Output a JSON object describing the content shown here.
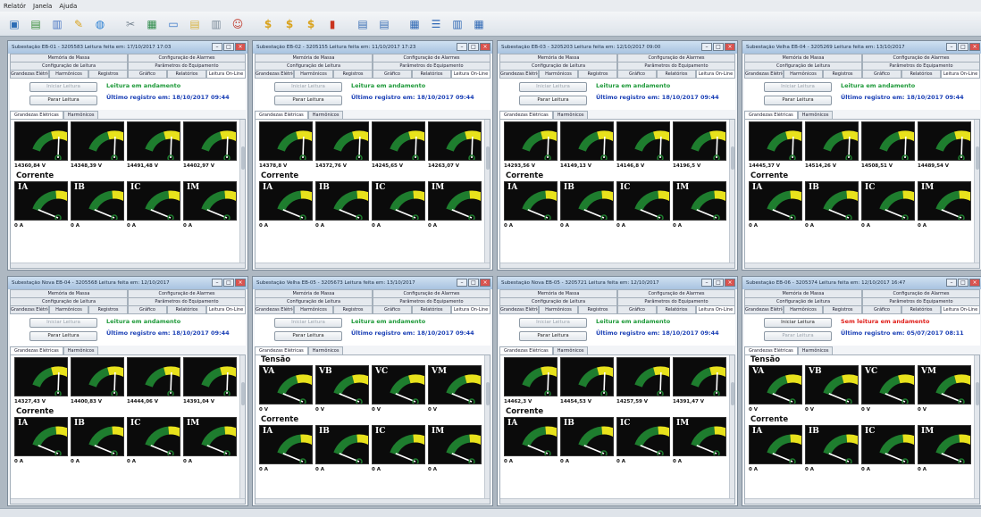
{
  "menu": [
    "Relatór",
    "Janela",
    "Ajuda"
  ],
  "toolbar_icons": [
    "window-icon",
    "chart-icon",
    "book-icon",
    "pen-icon",
    "globe-icon",
    "tool-icon",
    "device-icon",
    "screen-icon",
    "folder-icon",
    "copy-icon",
    "user-icon",
    "dollar-icon",
    "dollar-icon",
    "dollar-icon",
    "bars-icon",
    "doc-icon",
    "doc-icon",
    "cascade-icon",
    "tile-h-icon",
    "tile-v-icon",
    "grid-icon"
  ],
  "tab_labels": {
    "memoria": "Memória de Massa",
    "config_alarmes": "Configuração de Alarmes",
    "config_leitura": "Configuração de Leitura",
    "parametros": "Parâmetros do Equipamento",
    "grandezas": "Grandezas Elétricas",
    "harmonicos": "Harmônicos",
    "registros": "Registros",
    "graficos": "Gráfico",
    "relatorios": "Relatórios",
    "leitura_online": "Leitura On-Line"
  },
  "inner_tabs": {
    "grandezas": "Grandezas Elétricas",
    "harmonicos": "Harmônicos"
  },
  "buttons": {
    "iniciar": "Iniciar Leitura",
    "parar": "Parar Leitura"
  },
  "section_labels": {
    "corrente": "Corrente",
    "tensao": "Tensão"
  },
  "colors": {
    "ok_status": "#1f9a3a",
    "err_status": "#e0201b",
    "info": "#1a3fb5",
    "gauge_green": "#1e7d2e",
    "gauge_yellow": "#e8e21c",
    "gauge_red": "#d81e1e"
  },
  "windows": [
    {
      "title": "Subestação EB-01 - 3205583 Leitura feita em: 17/10/2017 17:03",
      "status": "Leitura em andamento",
      "status_kind": "ok",
      "last": "Último registro em: 18/10/2017 09:44",
      "voltage_labels": [
        "",
        "",
        "",
        ""
      ],
      "voltage_readings": [
        "14360,84 V",
        "14348,39 V",
        "14491,48 V",
        "14402,97 V"
      ],
      "voltage_level": 0.6,
      "current_labels": [
        "IA",
        "IB",
        "IC",
        "IM"
      ],
      "current_scale": [
        "225",
        "225",
        "225",
        "225"
      ],
      "current_readings": [
        "0 A",
        "0 A",
        "0 A",
        "0 A"
      ],
      "current_level": 0.02
    },
    {
      "title": "Subestação EB-02 - 3205155 Leitura feita em: 11/10/2017 17:23",
      "status": "Leitura em andamento",
      "status_kind": "ok",
      "last": "Último registro em: 18/10/2017 09:44",
      "voltage_labels": [
        "",
        "",
        "",
        ""
      ],
      "voltage_readings": [
        "14378,8 V",
        "14372,76 V",
        "14245,65 V",
        "14263,07 V"
      ],
      "voltage_level": 0.6,
      "current_labels": [
        "IA",
        "IB",
        "IC",
        "IM"
      ],
      "current_scale": [
        "60",
        "60",
        "60",
        "60"
      ],
      "current_readings": [
        "0 A",
        "0 A",
        "0 A",
        "0 A"
      ],
      "current_level": 0.02
    },
    {
      "title": "Subestação EB-03 - 3205203 Leitura feita em: 12/10/2017 09:00",
      "status": "Leitura em andamento",
      "status_kind": "ok",
      "last": "Último registro em: 18/10/2017 09:44",
      "voltage_labels": [
        "",
        "",
        "",
        ""
      ],
      "voltage_readings": [
        "14293,56 V",
        "14149,13 V",
        "14146,8 V",
        "14196,5 V"
      ],
      "voltage_level": 0.6,
      "current_labels": [
        "IA",
        "IB",
        "IC",
        "IM"
      ],
      "current_scale": [
        "225",
        "225",
        "225",
        "225"
      ],
      "current_readings": [
        "0 A",
        "0 A",
        "0 A",
        "0 A"
      ],
      "current_level": 0.02
    },
    {
      "title": "Subestação Velha EB-04 - 3205269 Leitura feita em: 13/10/2017",
      "status": "Leitura em andamento",
      "status_kind": "ok",
      "last": "Último registro em: 18/10/2017 09:44",
      "voltage_labels": [
        "",
        "",
        "",
        ""
      ],
      "voltage_readings": [
        "14445,37 V",
        "14514,26 V",
        "14508,51 V",
        "14489,54 V"
      ],
      "voltage_level": 0.6,
      "current_labels": [
        "IA",
        "IB",
        "IC",
        "IM"
      ],
      "current_scale": [
        "100",
        "100",
        "100",
        "100"
      ],
      "current_readings": [
        "0 A",
        "0 A",
        "0 A",
        "0 A"
      ],
      "current_level": 0.02
    },
    {
      "title": "Subestação Nova EB-04 - 3205568 Leitura feita em: 12/10/2017",
      "status": "Leitura em andamento",
      "status_kind": "ok",
      "last": "Último registro em: 18/10/2017 09:44",
      "voltage_labels": [
        "",
        "",
        "",
        ""
      ],
      "voltage_readings": [
        "14327,43 V",
        "14400,83 V",
        "14444,06 V",
        "14391,04 V"
      ],
      "voltage_level": 0.6,
      "current_labels": [
        "IA",
        "IB",
        "IC",
        "IM"
      ],
      "current_scale": [
        "70",
        "70",
        "70",
        "70"
      ],
      "current_readings": [
        "0 A",
        "0 A",
        "0 A",
        "0 A"
      ],
      "current_level": 0.02
    },
    {
      "title": "Subestação Velha EB-05 - 3205673 Leitura feita em: 13/10/2017",
      "status": "Leitura em andamento",
      "status_kind": "ok",
      "last": "Último registro em: 18/10/2017 09:44",
      "voltage_labels": [
        "VA",
        "VB",
        "VC",
        "VM"
      ],
      "voltage_readings": [
        "0 V",
        "0 V",
        "0 V",
        "0 V"
      ],
      "voltage_level": 0.02,
      "current_labels": [
        "IA",
        "IB",
        "IC",
        "IM"
      ],
      "current_scale": [
        "100",
        "100",
        "100",
        "100"
      ],
      "current_readings": [
        "0 A",
        "0 A",
        "0 A",
        "0 A"
      ],
      "current_level": 0.02
    },
    {
      "title": "Subestação Nova EB-05 - 3205721 Leitura feita em: 12/10/2017",
      "status": "Leitura em andamento",
      "status_kind": "ok",
      "last": "Último registro em: 18/10/2017 09:44",
      "voltage_labels": [
        "",
        "",
        "",
        ""
      ],
      "voltage_readings": [
        "14462,3 V",
        "14454,53 V",
        "14257,59 V",
        "14391,47 V"
      ],
      "voltage_level": 0.6,
      "current_labels": [
        "IA",
        "IB",
        "IC",
        "IM"
      ],
      "current_scale": [
        "60",
        "60",
        "60",
        "60"
      ],
      "current_readings": [
        "0 A",
        "0 A",
        "0 A",
        "0 A"
      ],
      "current_level": 0.02
    },
    {
      "title": "Subestação EB-06 - 3205374 Leitura feita em: 12/10/2017 16:47",
      "status": "Sem leitura em andamento",
      "status_kind": "err",
      "last": "Último registro em: 05/07/2017 08:11",
      "voltage_labels": [
        "VA",
        "VB",
        "VC",
        "VM"
      ],
      "voltage_readings": [
        "0 V",
        "0 V",
        "0 V",
        "0 V"
      ],
      "voltage_level": 0.02,
      "current_labels": [
        "IA",
        "IB",
        "IC",
        "IM"
      ],
      "current_scale": [
        "50",
        "50",
        "50",
        "50"
      ],
      "current_readings": [
        "0 A",
        "0 A",
        "0 A",
        "0 A"
      ],
      "current_level": 0.02
    }
  ]
}
